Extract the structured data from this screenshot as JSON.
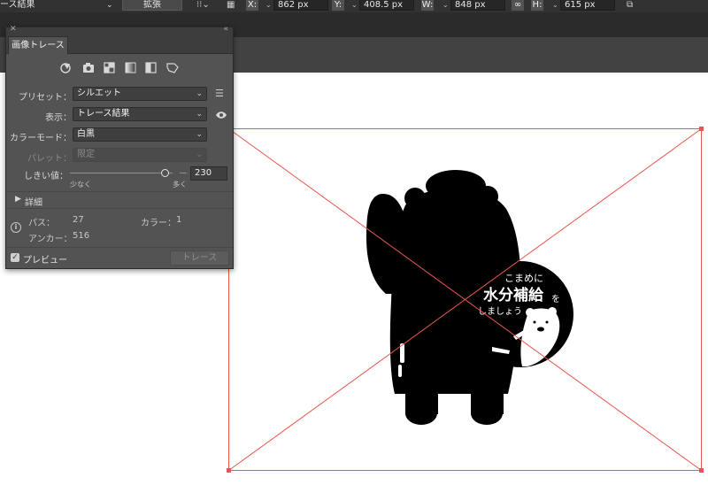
{
  "toolbar": {
    "view_label": "ース結果",
    "expand_button": "拡張",
    "x_label": "X:",
    "x_value": "862 px",
    "y_label": "Y:",
    "y_value": "408.5 px",
    "w_label": "W:",
    "w_value": "848 px",
    "h_label": "H:",
    "h_value": "615 px"
  },
  "panel": {
    "title": "画像トレース",
    "preset_label": "プリセット：",
    "preset_value": "シルエット",
    "view_label": "表示：",
    "view_value": "トレース結果",
    "mode_label": "カラーモード：",
    "mode_value": "白黒",
    "palette_label": "パレット：",
    "palette_value": "限定",
    "threshold_label": "しきい値：",
    "threshold_value": "230",
    "threshold_fraction": 0.92,
    "slider_min_label": "少なく",
    "slider_max_label": "多く",
    "advanced_label": "詳細",
    "paths_label": "パス：",
    "paths_value": "27",
    "colors_label": "カラー：",
    "colors_value": "1",
    "anchors_label": "アンカー：",
    "anchors_value": "516",
    "preview_label": "プレビュー",
    "trace_button": "トレース"
  },
  "artwork": {
    "text_line1": "こまめに",
    "text_line2": "水分補給",
    "text_particle": "を",
    "text_line3": "しましょう"
  },
  "colors": {
    "selection": "#e8564e",
    "panel_bg": "#535353",
    "ink": "#000000"
  }
}
